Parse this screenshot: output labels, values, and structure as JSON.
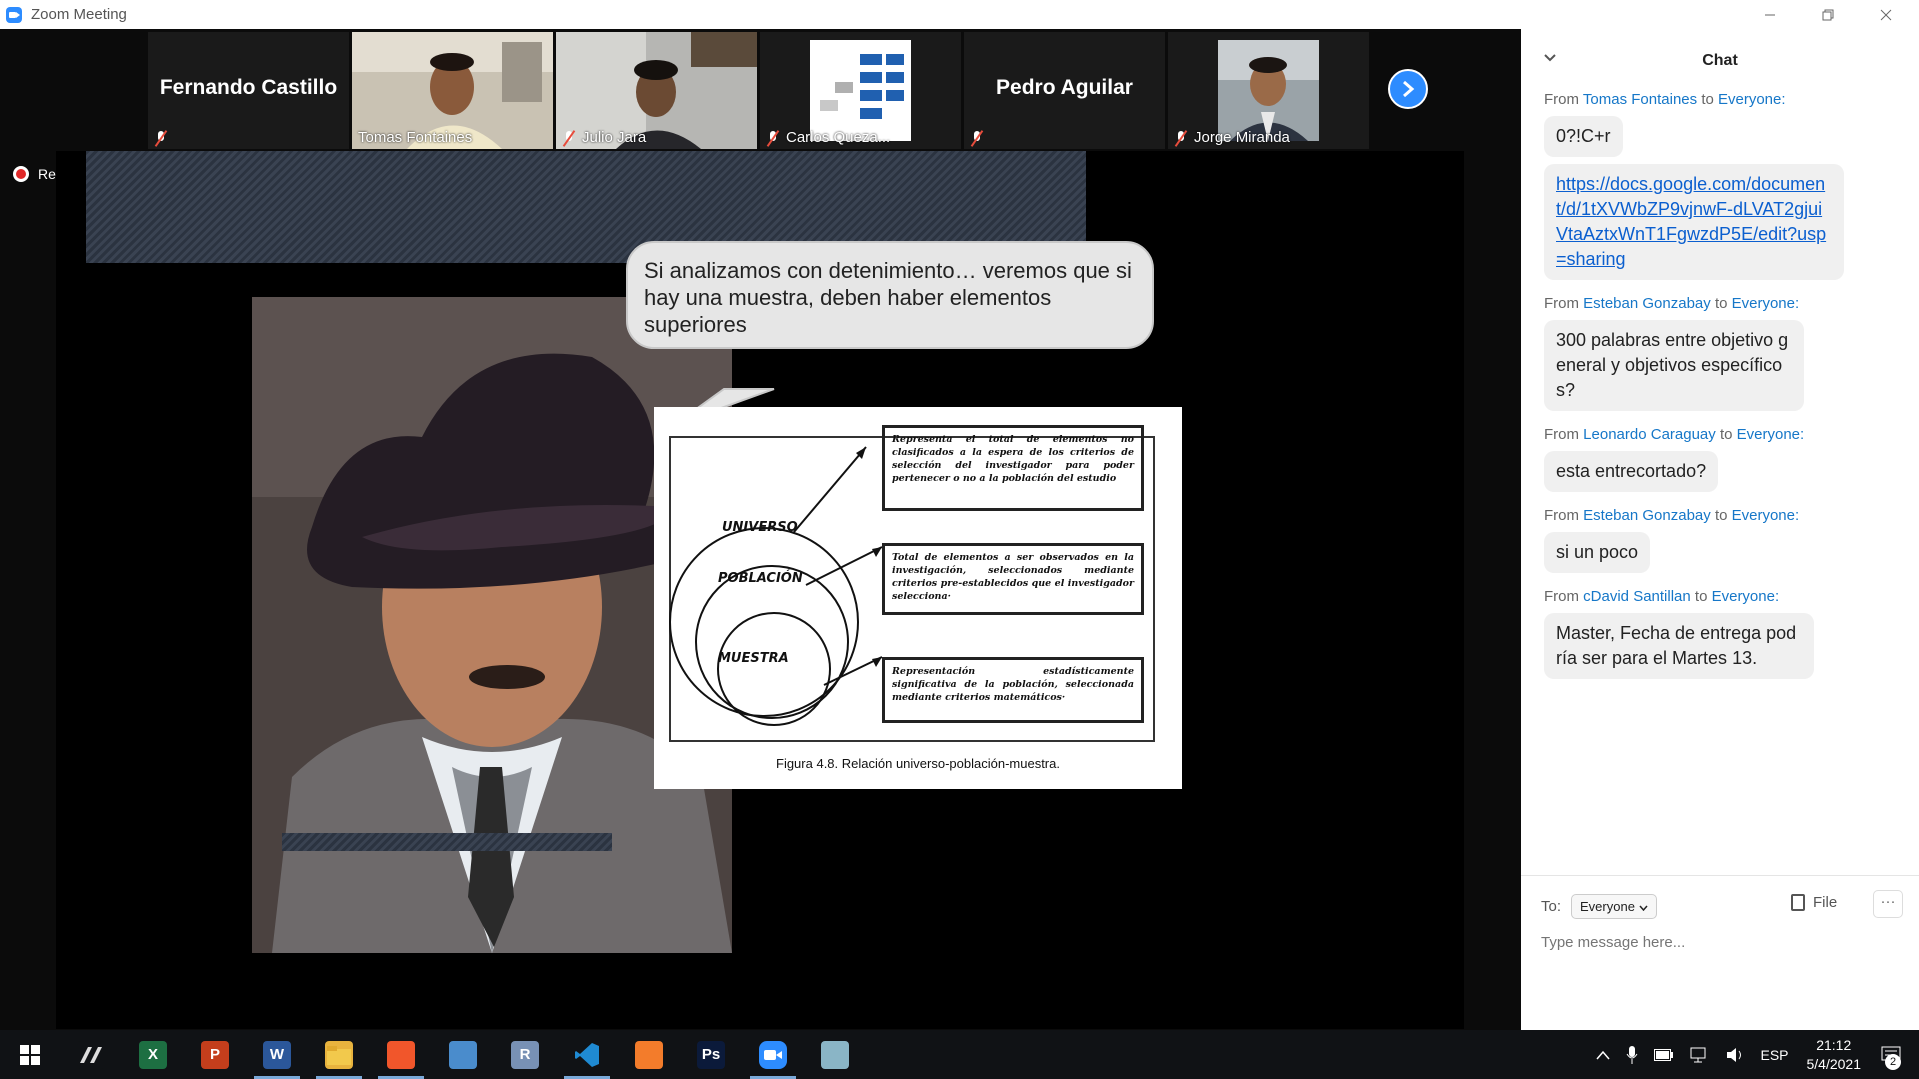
{
  "window": {
    "title": "Zoom Meeting",
    "minimize_icon": "minimize-icon",
    "restore_icon": "restore-icon",
    "close_icon": "close-icon"
  },
  "participants": [
    {
      "name": "Fernando Castillo",
      "video": false,
      "muted": true
    },
    {
      "name": "Tomas Fontaines",
      "video": true,
      "muted": false,
      "active": true
    },
    {
      "name": "Julio Jara",
      "video": true,
      "muted": true
    },
    {
      "name": "Carlos Queza...",
      "video": true,
      "muted": true
    },
    {
      "name": "Pedro Aguilar",
      "video": false,
      "muted": true
    },
    {
      "name": "Jorge Miranda",
      "video": true,
      "muted": true
    }
  ],
  "recording": {
    "label": "Recording"
  },
  "slide": {
    "bubble_text": "Si analizamos con detenimiento… veremos que si hay una muestra, deben haber elementos superiores",
    "figure": {
      "caption": "Figura 4.8. Relación universo-población-muestra.",
      "labels": {
        "universo": "UNIVERSO",
        "poblacion": "POBLACIÓN",
        "muestra": "MUESTRA"
      },
      "box1": "Representa el total de elementos no clasificados a la espera de los criterios de selección del investigador para poder pertenecer o no a la población del estudio",
      "box2": "Total de elementos a ser observados en la investigación, seleccionados mediante criterios pre-establecidos que el investigador selecciona·",
      "box3": "Representación estadísticamente significativa de la población, seleccionada mediante criterios matemáticos·"
    }
  },
  "chat": {
    "title": "Chat",
    "messages": [
      {
        "prefix": "From",
        "sender": "Tomas Fontaines",
        "to_word": "to",
        "recipient": "Everyone:",
        "text": "0?!C+r",
        "is_link": false
      },
      {
        "prefix": "",
        "sender": "",
        "to_word": "",
        "recipient": "",
        "text": "https://docs.google.com/document/d/1tXVWbZP9vjnwF-dLVAT2gjuiVtaAztxWnT1FgwzdP5E/edit?usp=sharing",
        "is_link": true
      },
      {
        "prefix": "From",
        "sender": "Esteban Gonzabay",
        "to_word": "to",
        "recipient": "Everyone:",
        "text": "300 palabras entre objetivo general y objetivos específicos?",
        "is_link": false
      },
      {
        "prefix": "From",
        "sender": "Leonardo Caraguay",
        "to_word": "to",
        "recipient": "Everyone:",
        "text": "esta entrecortado?",
        "is_link": false
      },
      {
        "prefix": "From",
        "sender": "Esteban Gonzabay",
        "to_word": "to",
        "recipient": "Everyone:",
        "text": "si un poco",
        "is_link": false
      },
      {
        "prefix": "From",
        "sender": "cDavid Santillan",
        "to_word": "to",
        "recipient": "Everyone:",
        "text": "Master, Fecha de entrega podría ser para el Martes 13.",
        "is_link": false
      }
    ],
    "to_label": "To:",
    "to_value": "Everyone",
    "file_label": "File",
    "more_label": "···",
    "input_placeholder": "Type message here..."
  },
  "taskbar": {
    "apps": [
      {
        "name": "vectorworks-icon",
        "label": "",
        "color": "#101215",
        "running": false
      },
      {
        "name": "excel-icon",
        "label": "X",
        "color": "#1d6f42",
        "running": false
      },
      {
        "name": "powerpoint-icon",
        "label": "P",
        "color": "#c43e1c",
        "running": false
      },
      {
        "name": "word-icon",
        "label": "W",
        "color": "#2b579a",
        "running": true
      },
      {
        "name": "file-explorer-icon",
        "label": "",
        "color": "#e8b33e",
        "running": true
      },
      {
        "name": "brave-icon",
        "label": "",
        "color": "#f1562b",
        "running": true
      },
      {
        "name": "control-panel-icon",
        "label": "",
        "color": "#4a8ccc",
        "running": false
      },
      {
        "name": "r-icon",
        "label": "R",
        "color": "#7891b5",
        "running": false
      },
      {
        "name": "vscode-icon",
        "label": "",
        "color": "#1f8ad2",
        "running": true
      },
      {
        "name": "xampp-icon",
        "label": "",
        "color": "#f37c2b",
        "running": false
      },
      {
        "name": "photoshop-icon",
        "label": "Ps",
        "color": "#0b1a3a",
        "running": false
      },
      {
        "name": "zoom-icon",
        "label": "",
        "color": "#2d8cff",
        "running": true
      },
      {
        "name": "paint-icon",
        "label": "",
        "color": "#8ab5c6",
        "running": false
      }
    ],
    "language": "ESP",
    "time": "21:12",
    "date": "5/4/2021",
    "notification_count": "2"
  }
}
